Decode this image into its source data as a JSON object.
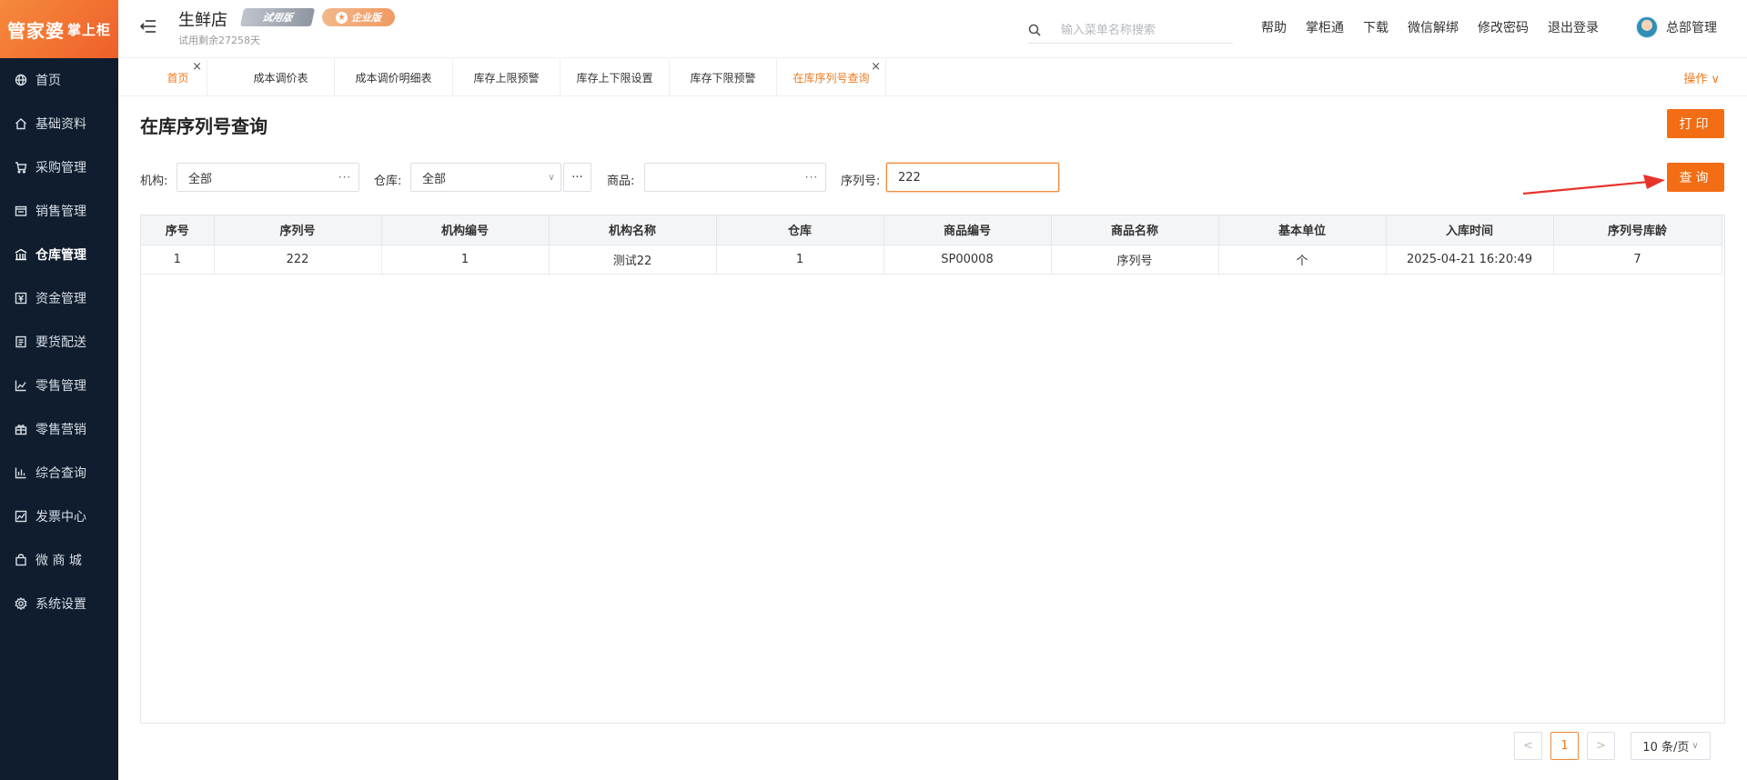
{
  "brand": {
    "logo_text": "管家婆",
    "logo_sub": "掌上柜"
  },
  "sidebar": {
    "items": [
      {
        "label": "首页",
        "icon": "globe-icon"
      },
      {
        "label": "基础资料",
        "icon": "home-icon"
      },
      {
        "label": "采购管理",
        "icon": "cart-icon"
      },
      {
        "label": "销售管理",
        "icon": "sales-icon"
      },
      {
        "label": "仓库管理",
        "icon": "warehouse-icon"
      },
      {
        "label": "资金管理",
        "icon": "money-icon"
      },
      {
        "label": "要货配送",
        "icon": "list-icon"
      },
      {
        "label": "零售管理",
        "icon": "chart-icon"
      },
      {
        "label": "零售营销",
        "icon": "gift-icon"
      },
      {
        "label": "综合查询",
        "icon": "bar-chart-icon"
      },
      {
        "label": "发票中心",
        "icon": "trend-icon"
      },
      {
        "label": "微 商 城",
        "icon": "bag-icon"
      },
      {
        "label": "系统设置",
        "icon": "gear-icon"
      }
    ]
  },
  "header": {
    "shop_name": "生鲜店",
    "trial_badge": "试用版",
    "enterprise_badge": "企业版",
    "trial_left": "试用剩余27258天",
    "search_placeholder": "输入菜单名称搜索",
    "links": [
      "帮助",
      "掌柜通",
      "下载",
      "微信解绑",
      "修改密码",
      "退出登录"
    ],
    "user_name": "总部管理"
  },
  "tabs": {
    "items": [
      "首页",
      "成本调价表",
      "成本调价明细表",
      "库存上限预警",
      "库存上下限设置",
      "库存下限预警",
      "在库序列号查询"
    ],
    "ops_label": "操作 ∨"
  },
  "page": {
    "title": "在库序列号查询",
    "print_label": "打印",
    "query_label": "查询"
  },
  "filters": {
    "org_label": "机构:",
    "org_value": "全部",
    "warehouse_label": "仓库:",
    "warehouse_value": "全部",
    "product_label": "商品:",
    "product_value": "",
    "serial_label": "序列号:",
    "serial_value": "222"
  },
  "table": {
    "headers": [
      "序号",
      "序列号",
      "机构编号",
      "机构名称",
      "仓库",
      "商品编号",
      "商品名称",
      "基本单位",
      "入库时间",
      "序列号库龄"
    ],
    "rows": [
      [
        "1",
        "222",
        "1",
        "测试22",
        "1",
        "SP00008",
        "序列号",
        "个",
        "2025-04-21 16:20:49",
        "7"
      ]
    ]
  },
  "pagination": {
    "prev": "<",
    "current": "1",
    "next": ">",
    "page_size": "10 条/页"
  },
  "colors": {
    "accent": "#f26d13",
    "sidebar_bg": "#0f1d2e"
  }
}
